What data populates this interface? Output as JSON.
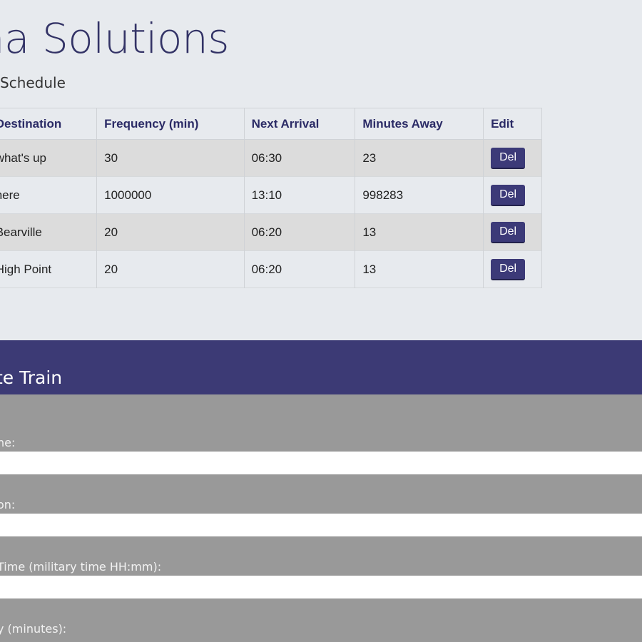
{
  "header": {
    "brand": "sha Solutions",
    "subtitle": "Schedule"
  },
  "table": {
    "headers": {
      "destination": "Destination",
      "frequency": "Frequency (min)",
      "next_arrival": "Next Arrival",
      "minutes_away": "Minutes Away",
      "edit": "Edit"
    },
    "rows": [
      {
        "destination": "what's up",
        "frequency": "30",
        "next_arrival": "06:30",
        "minutes_away": "23",
        "action": "Del"
      },
      {
        "destination": "here",
        "frequency": "1000000",
        "next_arrival": "13:10",
        "minutes_away": "998283",
        "action": "Del"
      },
      {
        "destination": "Bearville",
        "frequency": "20",
        "next_arrival": "06:20",
        "minutes_away": "13",
        "action": "Del"
      },
      {
        "destination": "High Point",
        "frequency": "20",
        "next_arrival": "06:20",
        "minutes_away": "13",
        "action": "Del"
      }
    ]
  },
  "form": {
    "title": "te Train",
    "fields": [
      {
        "label": "ne:",
        "value": ""
      },
      {
        "label": "on:",
        "value": ""
      },
      {
        "label": " Time (military time HH:mm):",
        "value": ""
      },
      {
        "label": "y (minutes):",
        "value": ""
      }
    ]
  },
  "colors": {
    "brand": "#333366",
    "panel_header": "#3c3a75",
    "form_background": "#999999",
    "button": "#3c3a78"
  }
}
